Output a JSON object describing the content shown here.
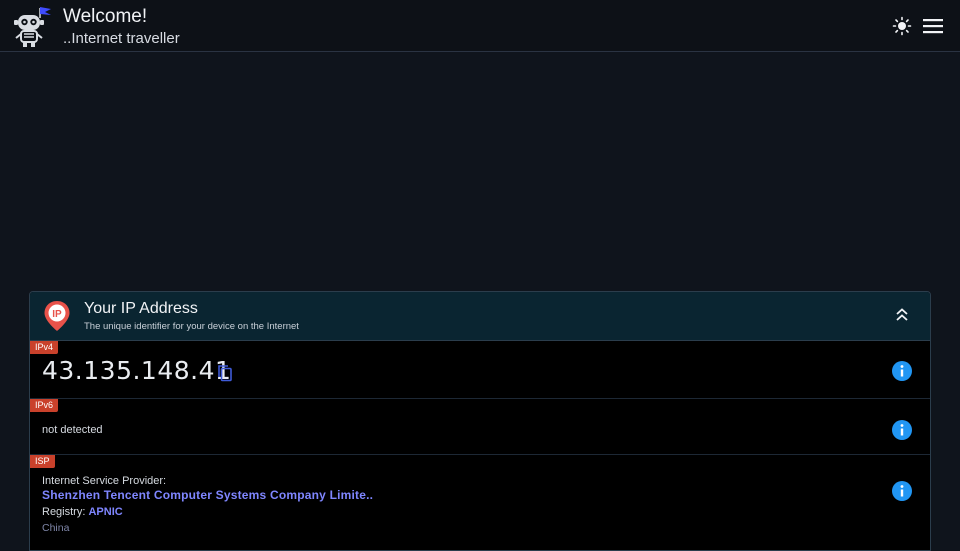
{
  "header": {
    "title": "Welcome!",
    "subtitle": "..Internet traveller",
    "logo_icon": "robot-icon",
    "theme_icon": "sun-icon",
    "menu_icon": "hamburger-menu-icon"
  },
  "ip_card": {
    "title": "Your IP Address",
    "subtitle": "The unique identifier for your device on the Internet",
    "icon": "ip-location-pin-icon",
    "collapse_icon": "chevron-double-up-icon",
    "ipv4": {
      "badge": "IPv4",
      "value": "43.135.148.41",
      "copy_icon": "copy-icon",
      "info_icon": "info-icon"
    },
    "ipv6": {
      "badge": "IPv6",
      "value": "not detected",
      "info_icon": "info-icon"
    },
    "isp": {
      "badge": "ISP",
      "label": "Internet Service Provider:",
      "name": "Shenzhen Tencent Computer Systems Company Limite..",
      "registry_label": "Registry:",
      "registry_value": "APNIC",
      "country": "China",
      "info_icon": "info-icon"
    }
  },
  "colors": {
    "badge": "#c9412b",
    "accent": "#7f86ff",
    "info": "#2196f3",
    "card_header": "#0a2531"
  }
}
